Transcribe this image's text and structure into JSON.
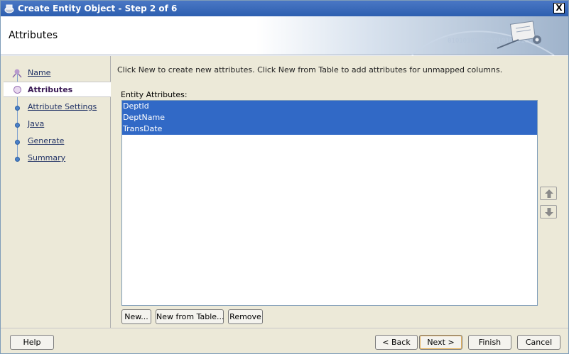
{
  "window": {
    "title": "Create Entity Object - Step 2 of 6",
    "close_label": "X"
  },
  "header": {
    "title": "Attributes",
    "decoration_text": "0101010101010101010101"
  },
  "nav": {
    "items": [
      {
        "label": "Name",
        "state": "visited"
      },
      {
        "label": "Attributes",
        "state": "active"
      },
      {
        "label": "Attribute Settings",
        "state": "pending"
      },
      {
        "label": "Java",
        "state": "pending"
      },
      {
        "label": "Generate",
        "state": "pending"
      },
      {
        "label": "Summary",
        "state": "pending"
      }
    ]
  },
  "main": {
    "instructions": "Click New to create new attributes.  Click New from Table to add attributes for unmapped columns.",
    "list_label": "Entity Attributes:",
    "attributes": [
      "DeptId",
      "DeptName",
      "TransDate"
    ],
    "buttons": {
      "new": "New...",
      "new_from_table": "New from Table...",
      "remove": "Remove"
    },
    "move_up_icon": "arrow-up-icon",
    "move_down_icon": "arrow-down-icon"
  },
  "footer": {
    "help": "Help",
    "back": "< Back",
    "next": "Next >",
    "finish": "Finish",
    "cancel": "Cancel"
  },
  "colors": {
    "title_bar": "#2d5fb0",
    "selection": "#3169c6",
    "panel": "#ece9d8"
  }
}
